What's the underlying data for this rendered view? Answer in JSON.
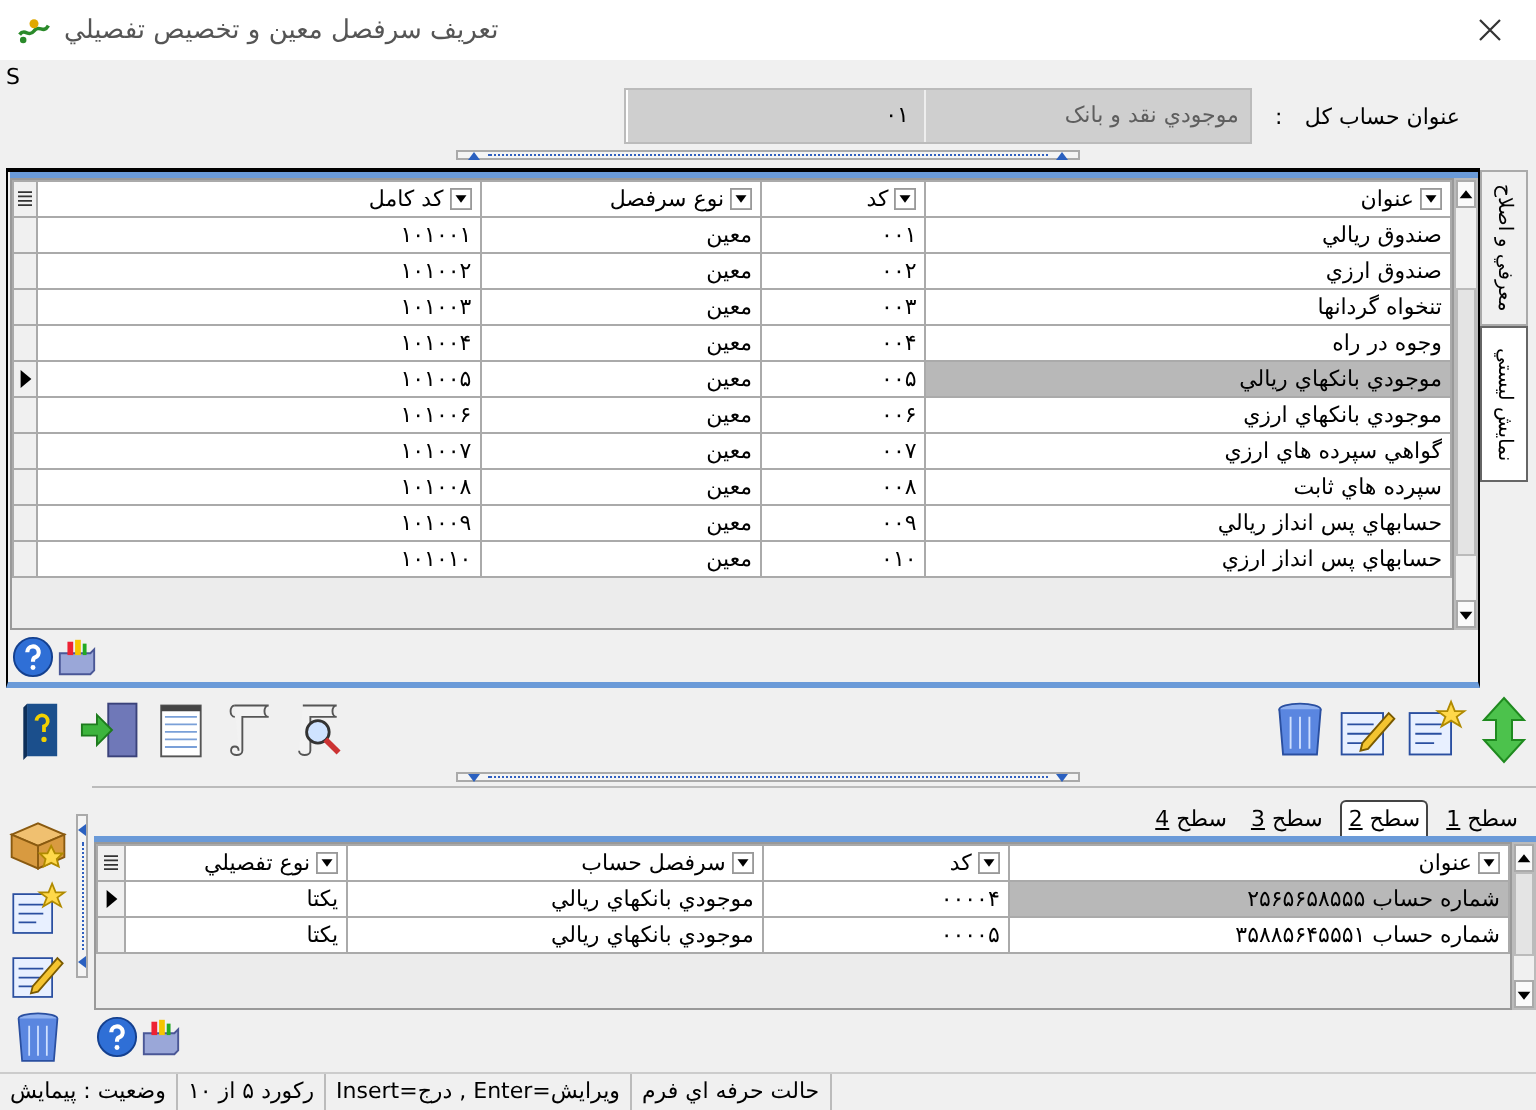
{
  "window": {
    "title": "تعريف سرفصل معين و تخصيص تفصيلي"
  },
  "corner_text": "S",
  "account": {
    "label": "عنوان حساب کل",
    "colon": ":",
    "name": "موجودي نقد و بانک",
    "code": "۰۱"
  },
  "side_tabs": [
    {
      "label": "معرفي و اصلاح",
      "selected": false
    },
    {
      "label": "نمايش ليستي",
      "selected": true
    }
  ],
  "table": {
    "columns": [
      "عنوان",
      "کد",
      "نوع سرفصل",
      "کد کامل"
    ],
    "rows": [
      {
        "cells": [
          "صندوق ريالي",
          "۰۰۱",
          "معين",
          "۱۰۱۰۰۱"
        ],
        "selected": false
      },
      {
        "cells": [
          "صندوق ارزي",
          "۰۰۲",
          "معين",
          "۱۰۱۰۰۲"
        ],
        "selected": false
      },
      {
        "cells": [
          "تنخواه گردانها",
          "۰۰۳",
          "معين",
          "۱۰۱۰۰۳"
        ],
        "selected": false
      },
      {
        "cells": [
          "وجوه در راه",
          "۰۰۴",
          "معين",
          "۱۰۱۰۰۴"
        ],
        "selected": false
      },
      {
        "cells": [
          "موجودي بانکهاي ريالي",
          "۰۰۵",
          "معين",
          "۱۰۱۰۰۵"
        ],
        "selected": true
      },
      {
        "cells": [
          "موجودي بانکهاي ارزي",
          "۰۰۶",
          "معين",
          "۱۰۱۰۰۶"
        ],
        "selected": false
      },
      {
        "cells": [
          "گواهي سپرده هاي ارزي",
          "۰۰۷",
          "معين",
          "۱۰۱۰۰۷"
        ],
        "selected": false
      },
      {
        "cells": [
          "سپرده هاي ثابت",
          "۰۰۸",
          "معين",
          "۱۰۱۰۰۸"
        ],
        "selected": false
      },
      {
        "cells": [
          "حسابهاي پس انداز ريالي",
          "۰۰۹",
          "معين",
          "۱۰۱۰۰۹"
        ],
        "selected": false
      },
      {
        "cells": [
          "حسابهاي پس انداز ارزي",
          "۰۱۰",
          "معين",
          "۱۰۱۰۱۰"
        ],
        "selected": false
      }
    ]
  },
  "level_tabs": [
    {
      "label": "سطح",
      "key": "1",
      "selected": false
    },
    {
      "label": "سطح",
      "key": "2",
      "selected": true
    },
    {
      "label": "سطح",
      "key": "3",
      "selected": false
    },
    {
      "label": "سطح",
      "key": "4",
      "selected": false
    }
  ],
  "detail_table": {
    "columns": [
      "عنوان",
      "کد",
      "سرفصل حساب",
      "نوع تفصيلي"
    ],
    "rows": [
      {
        "cells": [
          "شماره حساب ۲۵۶۵۶۵۸۵۵۵",
          "۰۰۰۰۴",
          "موجودي بانکهاي ريالي",
          "يکتا"
        ],
        "selected": true
      },
      {
        "cells": [
          "شماره حساب ۳۵۸۸۵۶۴۵۵۵۱",
          "۰۰۰۰۵",
          "موجودي بانکهاي ريالي",
          "يکتا"
        ],
        "selected": false
      }
    ]
  },
  "status_bar": [
    "حالت حرفه اي فرم",
    "Insert=درج , Enter=ويرايش",
    "رکورد ۵ از ۱۰",
    "وضعيت : پيمايش"
  ]
}
